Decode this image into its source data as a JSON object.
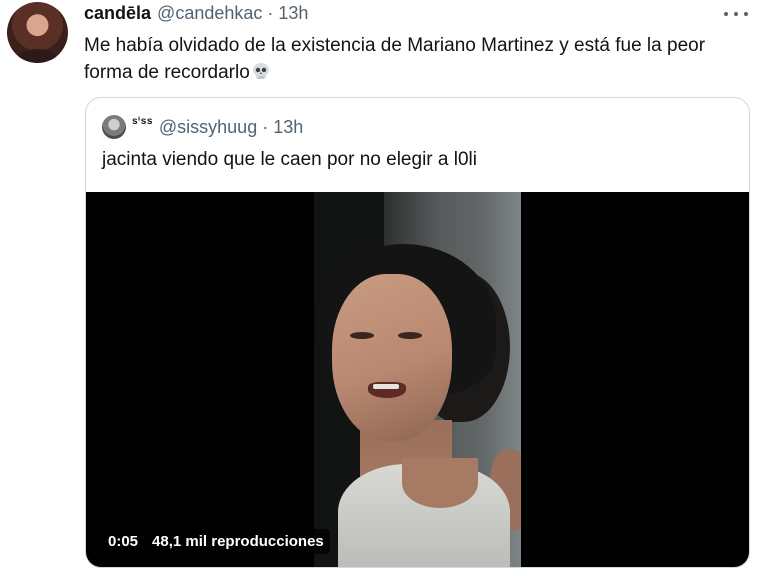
{
  "tweet": {
    "author": {
      "name": "candēla",
      "handle": "@candehkac",
      "time": "13h"
    },
    "separator": "·",
    "text": "Me había olvidado de la existencia de Mariano Martinez y está fue la peor forma de recordarlo",
    "emoji": "skull-icon",
    "more_icon": "more-horizontal-icon"
  },
  "quote": {
    "author": {
      "name": "sⁱss",
      "handle": "@sissyhuug",
      "time": "13h"
    },
    "separator": "·",
    "text": "jacinta viendo que le caen por no elegir a l0li",
    "video": {
      "duration": "0:05",
      "views": "48,1 mil reproducciones"
    }
  },
  "colors": {
    "text_primary": "#0f1419",
    "text_secondary": "#536471",
    "border": "#cfd9de",
    "video_bg": "#000000"
  }
}
